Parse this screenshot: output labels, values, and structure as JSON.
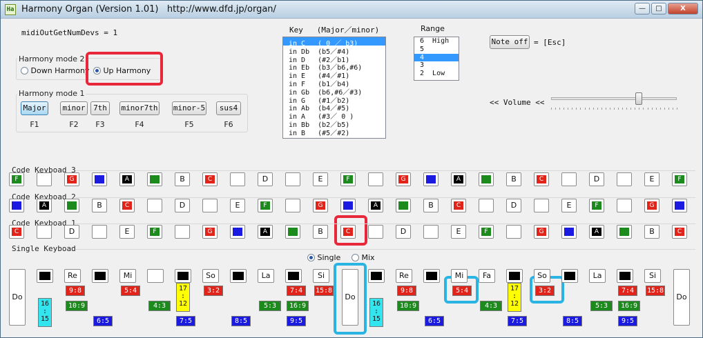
{
  "window": {
    "title": "Harmony Organ (Version 1.01)   http://www.dfd.jp/organ/",
    "icon_text": "Ha",
    "minimize": "—",
    "maximize": "□",
    "close": "X"
  },
  "status_text": "midiOutGetNumDevs = 1",
  "harmony_mode2": {
    "title": "Harmony mode 2",
    "options": [
      {
        "label": "Down Harmony",
        "selected": false
      },
      {
        "label": "Up Harmony",
        "selected": true
      }
    ]
  },
  "harmony_mode1": {
    "title": "Harmony mode 1",
    "buttons": [
      {
        "label": "Major",
        "key": "F1",
        "selected": true
      },
      {
        "label": "minor",
        "key": "F2",
        "selected": false
      },
      {
        "label": "7th",
        "key": "F3",
        "selected": false
      },
      {
        "label": "minor7th",
        "key": "F4",
        "selected": false
      },
      {
        "label": "minor-5",
        "key": "F5",
        "selected": false
      },
      {
        "label": "sus4",
        "key": "F6",
        "selected": false
      }
    ]
  },
  "key_list": {
    "header": "Key   (Major／minor)",
    "items": [
      "in C   ( 0 ／ b3)",
      "in Db  (b5／#4)",
      "in D   (#2／b1)",
      "in Eb  (b3／b6,#6)",
      "in E   (#4／#1)",
      "in F   (b1／b4)",
      "in Gb  (b6,#6／#3)",
      "in G   (#1／b2)",
      "in Ab  (b4／#5)",
      "in A   (#3／ 0 )",
      "in Bb  (b2／b5)",
      "in B   (#5／#2)"
    ],
    "selected_index": 0
  },
  "range": {
    "label": "Range",
    "items": [
      "6  High",
      "5",
      "4",
      "3",
      "2  Low"
    ],
    "selected_index": 2
  },
  "note_off": {
    "button": "Note off",
    "hint": "= [Esc]"
  },
  "volume": {
    "label": "<< Volume <<",
    "level_percent": 70
  },
  "code_keyboards": [
    {
      "label": "Code Keyboad 3",
      "keys": [
        {
          "c": "green",
          "t": "F"
        },
        {
          "c": "white",
          "t": ""
        },
        {
          "c": "red",
          "t": "G"
        },
        {
          "c": "blue",
          "t": ""
        },
        {
          "c": "black",
          "t": "A"
        },
        {
          "c": "green",
          "t": ""
        },
        {
          "c": "white",
          "t": "B"
        },
        {
          "c": "red",
          "t": "C"
        },
        {
          "c": "white",
          "t": ""
        },
        {
          "c": "white",
          "t": "D"
        },
        {
          "c": "white",
          "t": ""
        },
        {
          "c": "white",
          "t": "E"
        },
        {
          "c": "green",
          "t": "F"
        },
        {
          "c": "white",
          "t": ""
        },
        {
          "c": "red",
          "t": "G"
        },
        {
          "c": "blue",
          "t": ""
        },
        {
          "c": "black",
          "t": "A"
        },
        {
          "c": "green",
          "t": ""
        },
        {
          "c": "white",
          "t": "B"
        },
        {
          "c": "red",
          "t": "C"
        },
        {
          "c": "white",
          "t": ""
        },
        {
          "c": "white",
          "t": "D"
        },
        {
          "c": "white",
          "t": ""
        },
        {
          "c": "white",
          "t": "E"
        },
        {
          "c": "green",
          "t": "F"
        }
      ]
    },
    {
      "label": "Code Keyboad 2",
      "keys": [
        {
          "c": "blue",
          "t": ""
        },
        {
          "c": "black",
          "t": "A"
        },
        {
          "c": "green",
          "t": ""
        },
        {
          "c": "white",
          "t": "B"
        },
        {
          "c": "red",
          "t": "C"
        },
        {
          "c": "white",
          "t": ""
        },
        {
          "c": "white",
          "t": "D"
        },
        {
          "c": "white",
          "t": ""
        },
        {
          "c": "white",
          "t": "E"
        },
        {
          "c": "green",
          "t": "F"
        },
        {
          "c": "white",
          "t": ""
        },
        {
          "c": "red",
          "t": "G"
        },
        {
          "c": "blue",
          "t": ""
        },
        {
          "c": "black",
          "t": "A"
        },
        {
          "c": "green",
          "t": ""
        },
        {
          "c": "white",
          "t": "B"
        },
        {
          "c": "red",
          "t": "C"
        },
        {
          "c": "white",
          "t": ""
        },
        {
          "c": "white",
          "t": "D"
        },
        {
          "c": "white",
          "t": ""
        },
        {
          "c": "white",
          "t": "E"
        },
        {
          "c": "green",
          "t": "F"
        },
        {
          "c": "white",
          "t": ""
        },
        {
          "c": "red",
          "t": "G"
        },
        {
          "c": "blue",
          "t": ""
        }
      ]
    },
    {
      "label": "Code Keyboad 1",
      "keys": [
        {
          "c": "red",
          "t": "C"
        },
        {
          "c": "white",
          "t": ""
        },
        {
          "c": "white",
          "t": "D"
        },
        {
          "c": "white",
          "t": ""
        },
        {
          "c": "white",
          "t": "E"
        },
        {
          "c": "green",
          "t": "F"
        },
        {
          "c": "white",
          "t": ""
        },
        {
          "c": "red",
          "t": "G"
        },
        {
          "c": "blue",
          "t": ""
        },
        {
          "c": "black",
          "t": "A"
        },
        {
          "c": "green",
          "t": ""
        },
        {
          "c": "white",
          "t": "B"
        },
        {
          "c": "red",
          "t": "C"
        },
        {
          "c": "white",
          "t": ""
        },
        {
          "c": "white",
          "t": "D"
        },
        {
          "c": "white",
          "t": ""
        },
        {
          "c": "white",
          "t": "E"
        },
        {
          "c": "green",
          "t": "F"
        },
        {
          "c": "white",
          "t": ""
        },
        {
          "c": "red",
          "t": "G"
        },
        {
          "c": "blue",
          "t": ""
        },
        {
          "c": "black",
          "t": "A"
        },
        {
          "c": "green",
          "t": ""
        },
        {
          "c": "white",
          "t": "B"
        },
        {
          "c": "red",
          "t": "C"
        }
      ]
    }
  ],
  "single_keyboard": {
    "label": "Single Keyboad",
    "mode_options": [
      {
        "label": "Single",
        "selected": true
      },
      {
        "label": "Mix",
        "selected": false
      }
    ],
    "do_label": "Do",
    "note_labels": [
      "Re",
      "Mi",
      "So",
      "La",
      "Si",
      "Re",
      "Mi",
      "Fa",
      "So",
      "La",
      "Si"
    ],
    "ratios": [
      "9:8",
      "5:4",
      "3:2",
      "7:4",
      "15:8",
      "9:8",
      "5:4",
      "3:2",
      "7:4",
      "15:8",
      "10:9",
      "4:3",
      "5:3",
      "16:9",
      "10:9",
      "4:3",
      "5:3",
      "16:9",
      "6:5",
      "7:5",
      "8:5",
      "9:5",
      "6:5",
      "7:5",
      "8:5",
      "9:5",
      "16\n:\n15",
      "17\n:\n12",
      "16\n:\n15",
      "17\n:\n12"
    ]
  },
  "colors": {
    "red": "#e2231a",
    "green": "#1d8a1d",
    "blue": "#1a1ae0",
    "highlight_red": "#e8273a",
    "highlight_cyan": "#2ab4e4"
  }
}
